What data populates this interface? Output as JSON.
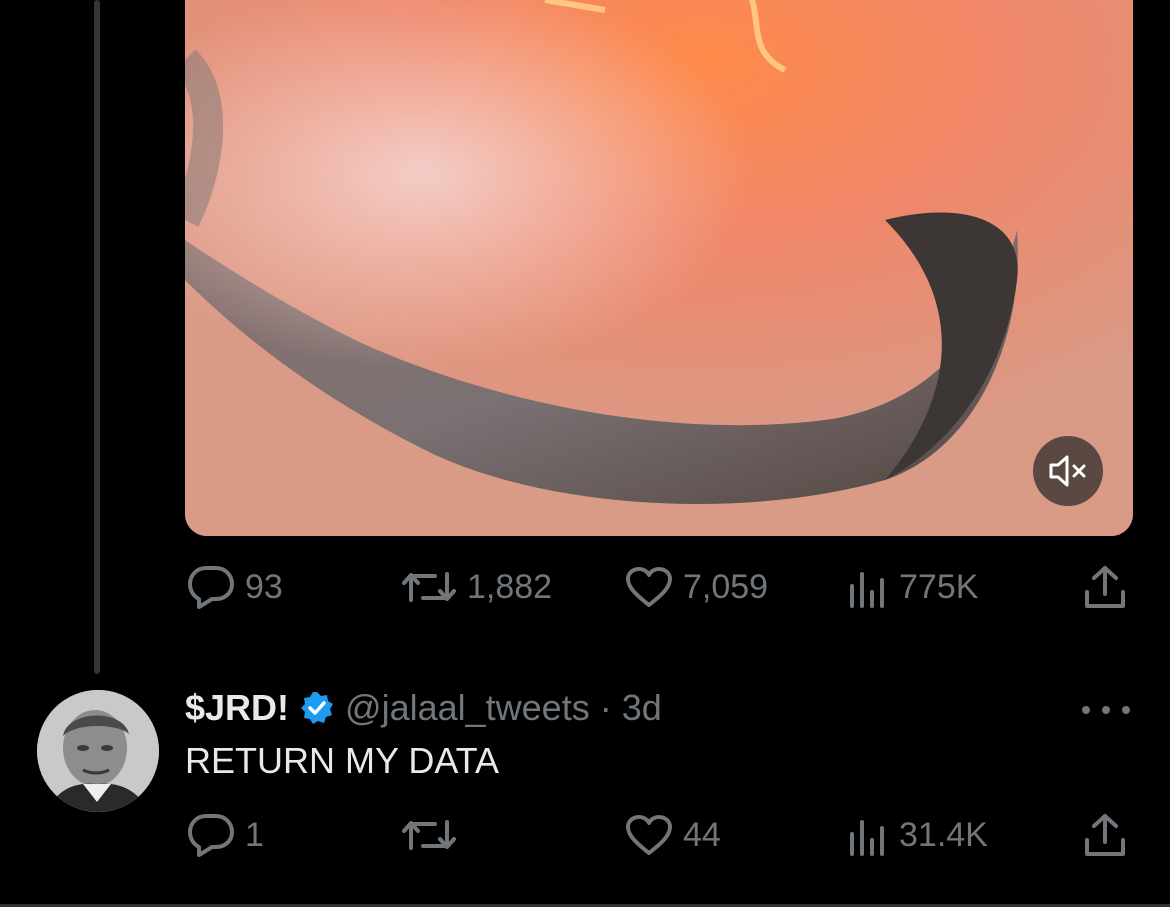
{
  "colors": {
    "background": "#000000",
    "text_primary": "#e7e9ea",
    "text_secondary": "#71767b",
    "verified_badge": "#1d9bf0",
    "thread_line": "#333639"
  },
  "media": {
    "mute_icon": "speaker-muted-icon"
  },
  "main_tweet": {
    "replies": "93",
    "reposts": "1,882",
    "likes": "7,059",
    "views": "775K"
  },
  "reply_tweet": {
    "display_name": "$JRD!",
    "handle": "@jalaal_tweets",
    "time": "· 3d",
    "text": "RETURN MY DATA",
    "replies": "1",
    "reposts": "",
    "likes": "44",
    "views": "31.4K"
  },
  "icons": {
    "reply": "reply-bubble-icon",
    "repost": "repost-arrows-icon",
    "like": "heart-icon",
    "views": "bar-chart-icon",
    "share": "share-upload-icon",
    "verified": "verified-badge-icon",
    "more": "more-dots-icon"
  }
}
